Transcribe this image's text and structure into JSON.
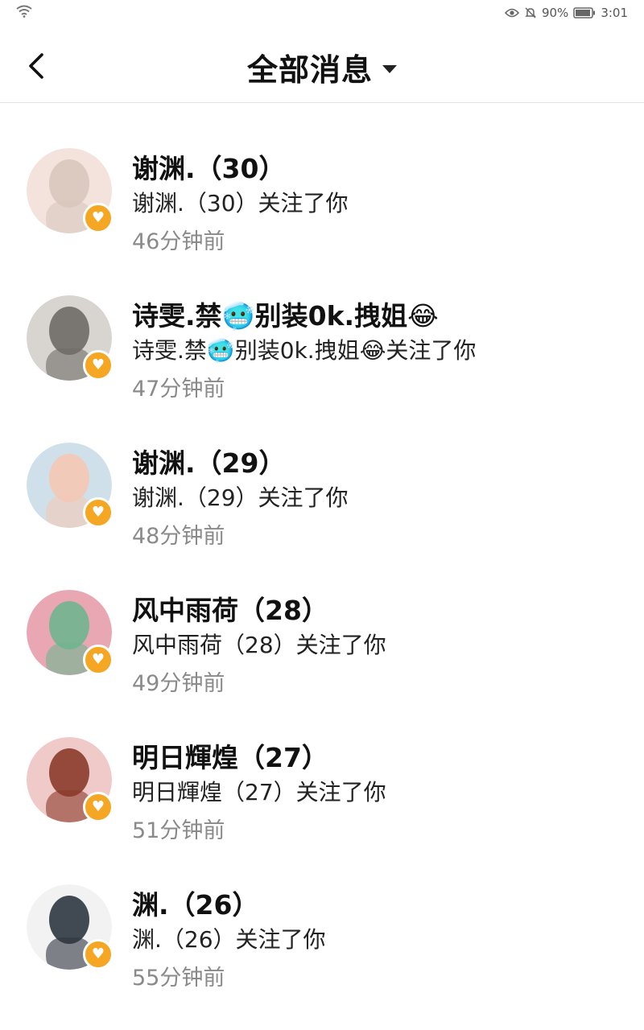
{
  "status_bar": {
    "battery": "90%",
    "time": "3:01"
  },
  "header": {
    "title": "全部消息"
  },
  "colors": {
    "badge": "#f5a623"
  },
  "items": [
    {
      "name": "谢渊.（30）",
      "message": "谢渊.（30）关注了你",
      "time": "46分钟前",
      "avatar_colors": [
        "#f3e3dc",
        "#d9c6bd"
      ]
    },
    {
      "name": "诗雯.禁🥶别装0k.拽姐😂",
      "message": "诗雯.禁🥶别装0k.拽姐😂关注了你",
      "time": "47分钟前",
      "avatar_colors": [
        "#d8d4cf",
        "#6f6a66"
      ]
    },
    {
      "name": "谢渊.（29）",
      "message": "谢渊.（29）关注了你",
      "time": "48分钟前",
      "avatar_colors": [
        "#cfe0ea",
        "#f4c8b4"
      ]
    },
    {
      "name": "风中雨荷（28）",
      "message": "风中雨荷（28）关注了你",
      "time": "49分钟前",
      "avatar_colors": [
        "#e9a7b4",
        "#6fb58f"
      ]
    },
    {
      "name": "明日輝煌（27）",
      "message": "明日輝煌（27）关注了你",
      "time": "51分钟前",
      "avatar_colors": [
        "#f0c9c9",
        "#8a3b2a"
      ]
    },
    {
      "name": "渊.（26）",
      "message": "渊.（26）关注了你",
      "time": "55分钟前",
      "avatar_colors": [
        "#f2f2f2",
        "#2e3640"
      ]
    }
  ]
}
